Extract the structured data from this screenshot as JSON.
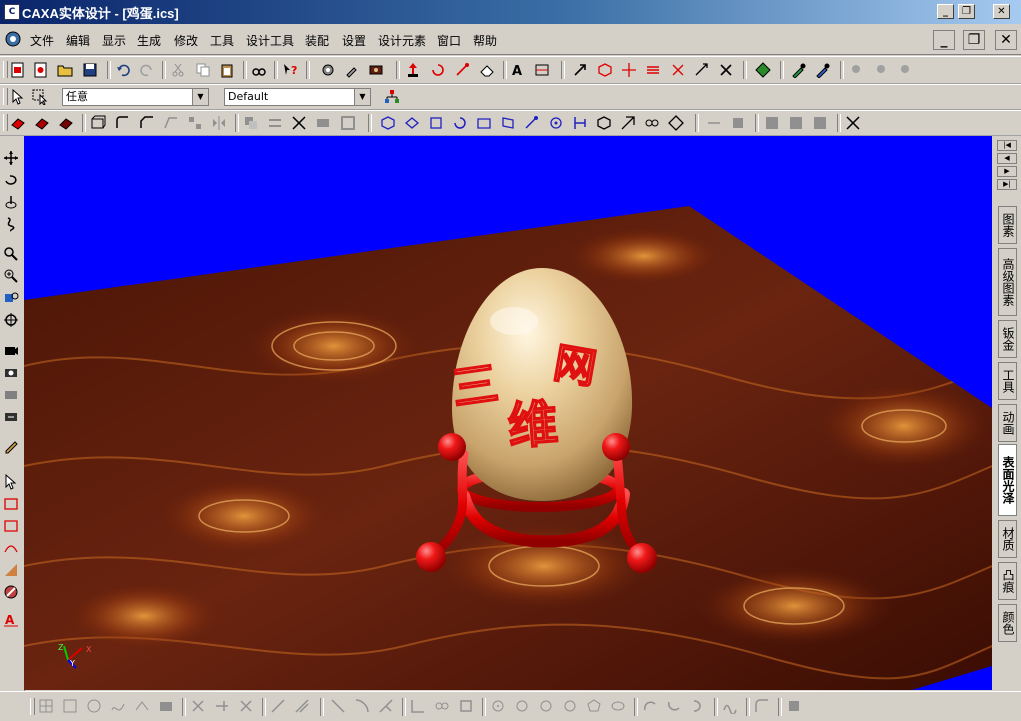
{
  "window": {
    "title": "CAXA实体设计 - [鸡蛋.ics]",
    "icon_label": "C",
    "controls": [
      "minimize-icon",
      "restore-icon",
      "close-icon"
    ]
  },
  "menubar": {
    "items": [
      "文件",
      "编辑",
      "显示",
      "生成",
      "修改",
      "工具",
      "设计工具",
      "装配",
      "设置",
      "设计元素",
      "窗口",
      "帮助"
    ]
  },
  "selection_bar": {
    "filter_value": "任意",
    "style_value": "Default"
  },
  "right_panel": {
    "tabs": [
      "图素",
      "高级图素",
      "钣金",
      "工具",
      "动画",
      "表面光泽",
      "材质",
      "凸痕",
      "颜色"
    ],
    "active_tab": "表面光泽"
  },
  "scene": {
    "egg_text": [
      "三",
      "维",
      "网"
    ],
    "axis_labels": [
      "X",
      "Y",
      "Z"
    ],
    "colors": {
      "background": "#0000ff",
      "egg": "#e2c896",
      "stand": "#e00000",
      "wood": "#5a1a08"
    }
  },
  "colors": {
    "titlebar_start": "#0a246a",
    "titlebar_end": "#a6caf0",
    "chrome": "#d4d0c8"
  }
}
